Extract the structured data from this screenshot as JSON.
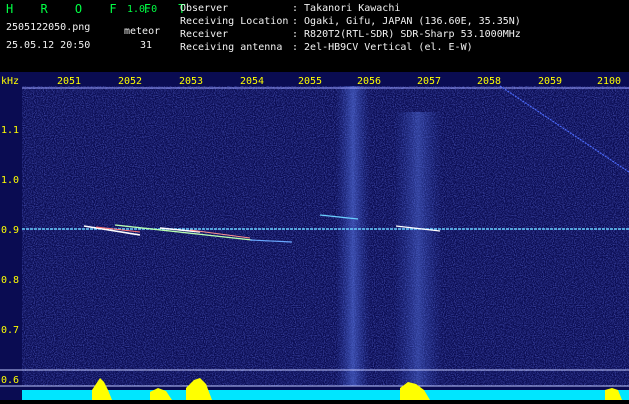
{
  "app": {
    "name": "H R O F F T",
    "version": "1.0.0"
  },
  "capture": {
    "filename": "2505122050.png",
    "datetime": "25.05.12 20:50",
    "meteor_label": "meteor",
    "meteor_count": "31"
  },
  "info": [
    {
      "key": "Observer",
      "value": ": Takanori Kawachi"
    },
    {
      "key": "Receiving Location",
      "value": ": Ogaki, Gifu, JAPAN (136.60E, 35.35N)"
    },
    {
      "key": "Receiver",
      "value": ": R820T2(RTL-SDR) SDR-Sharp 53.1000MHz"
    },
    {
      "key": "Receiving antenna",
      "value": ": 2el-HB9CV Vertical (el. E-W)"
    }
  ],
  "spectrogram": {
    "y_unit": "kHz",
    "y_ticks": [
      "1.1",
      "1.0",
      "0.9",
      "0.8",
      "0.7",
      "0.6"
    ],
    "time_ticks": [
      "2051",
      "2052",
      "2053",
      "2054",
      "2055",
      "2056",
      "2057",
      "2058",
      "2059",
      "2100"
    ],
    "colors": {
      "background": "#0a0c52",
      "tick_text": "#ffff00",
      "header_text": "#f2f2f2",
      "logo": "#00ff44"
    }
  }
}
